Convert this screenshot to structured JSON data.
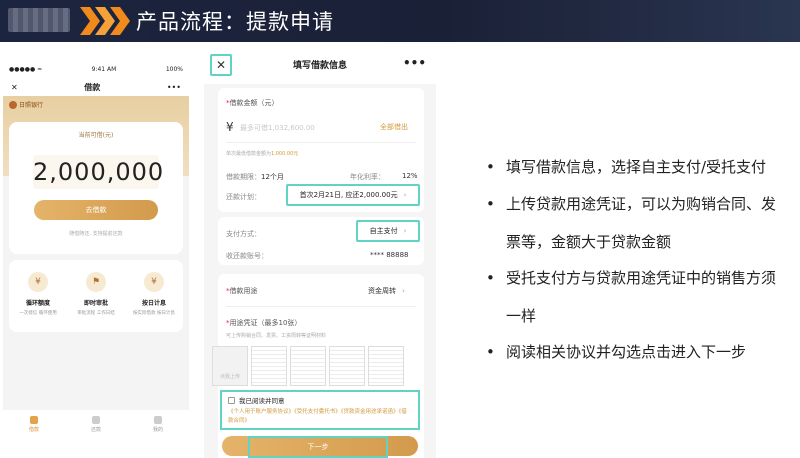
{
  "header": {
    "title": "产品流程：提款申请"
  },
  "phone1": {
    "status": {
      "time": "9:41 AM",
      "battery": "100%"
    },
    "nav_title": "借款",
    "bank_name": "日照银行",
    "card_label": "当前可借(元)",
    "amount": "2,000,000",
    "borrow_button": "去借款",
    "note": "随借随还, 支持提前还款",
    "features": [
      {
        "title": "循环额度",
        "sub": "一次授信 循环使用",
        "icon": "¥"
      },
      {
        "title": "即时审批",
        "sub": "审批流程 工作日结",
        "icon": "⚑"
      },
      {
        "title": "按日计息",
        "sub": "按实际借款 按日计息",
        "icon": "¥"
      }
    ],
    "tabs": [
      {
        "label": "借款",
        "active": true
      },
      {
        "label": "还款",
        "active": false
      },
      {
        "label": "我的",
        "active": false
      }
    ]
  },
  "phone2": {
    "nav_title": "填写借款信息",
    "amount_label": "借款金额（元）",
    "currency": "¥",
    "amount_placeholder": "最多可借1,032,600.00",
    "borrow_all": "全部借出",
    "min_hint_prefix": "单次最低借款金额为",
    "min_hint_value": "1,000.00元",
    "term_label": "借款期限：",
    "term_value": "12个月",
    "rate_label": "年化利率：",
    "rate_value": "12%",
    "plan_label": "还款计划：",
    "plan_value": "首次2月21日, 应还2,000.00元",
    "payment_label": "支付方式：",
    "payment_value": "自主支付",
    "account_label": "收还款账号：",
    "account_value": "**** 88888",
    "purpose_label": "借款用途",
    "purpose_value": "资金周转",
    "voucher_label": "用途凭证（最多10张）",
    "voucher_hint": "可上传购销合同、发票、工资周转等证明材料",
    "upload_label": "点我上传",
    "agree_text": "我已阅读并同意",
    "agree_links": "《个人用于账户服务协议》《受托支付委托书》《贷款资金用途承诺函》《借款合同》",
    "next_button": "下一步"
  },
  "bullets": [
    "填写借款信息，选择自主支付/受托支付",
    "上传贷款用途凭证，可以为购销合同、发票等，金额大于贷款金额",
    "受托支付方与贷款用途凭证中的销售方须一样",
    "阅读相关协议并勾选点击进入下一步"
  ]
}
